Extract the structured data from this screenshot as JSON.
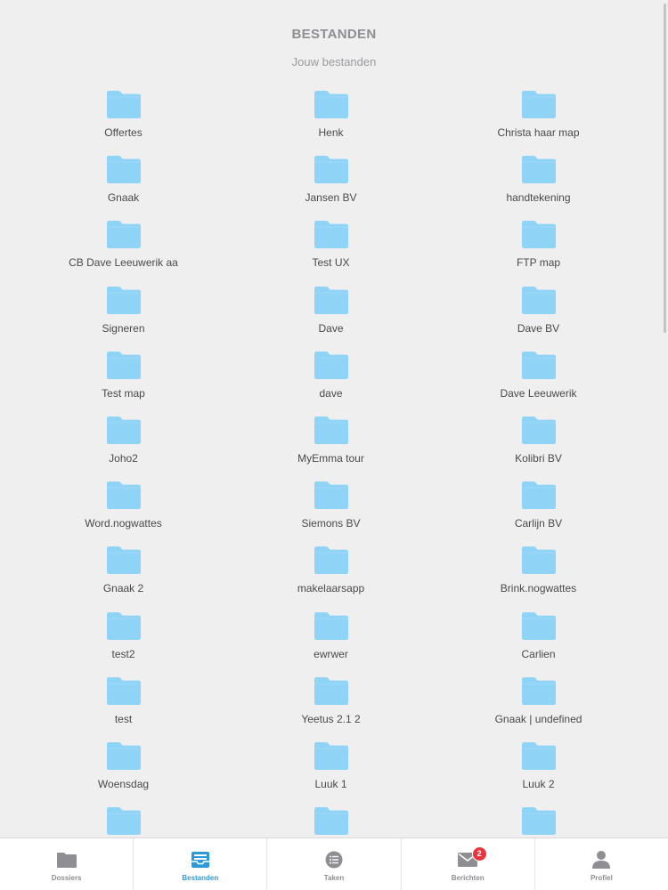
{
  "header": {
    "title": "BESTANDEN",
    "subtitle": "Jouw bestanden"
  },
  "folders": [
    "Offertes",
    "Henk",
    "Christa haar map",
    "Gnaak",
    "Jansen BV",
    "handtekening",
    "CB Dave Leeuwerik aa",
    "Test UX",
    "FTP map",
    "Signeren",
    "Dave",
    "Dave BV",
    "Test map",
    "dave",
    "Dave Leeuwerik",
    "Joho2",
    "MyEmma tour",
    "Kolibri BV",
    "Word.nogwattes",
    "Siemons BV",
    "Carlijn BV",
    "Gnaak 2",
    "makelaarsapp",
    "Brink.nogwattes",
    "test2",
    "ewrwer",
    "Carlien",
    "test",
    "Yeetus 2.1 2",
    "Gnaak | undefined",
    "Woensdag",
    "Luuk 1",
    "Luuk 2",
    "",
    "",
    ""
  ],
  "tabbar": {
    "dossiers": {
      "label": "Dossiers",
      "icon": "folder-icon"
    },
    "bestanden": {
      "label": "Bestanden",
      "icon": "inbox-tray-icon"
    },
    "taken": {
      "label": "Taken",
      "icon": "list-icon"
    },
    "berichten": {
      "label": "Berichten",
      "icon": "envelope-icon",
      "badge": "2"
    },
    "profiel": {
      "label": "Profiel",
      "icon": "person-icon"
    }
  },
  "colors": {
    "background": "#efefef",
    "folder": "#8fd3f6",
    "active_tab": "#2d9ad8",
    "inactive_tab": "#8e8e93",
    "badge": "#e8363f"
  }
}
